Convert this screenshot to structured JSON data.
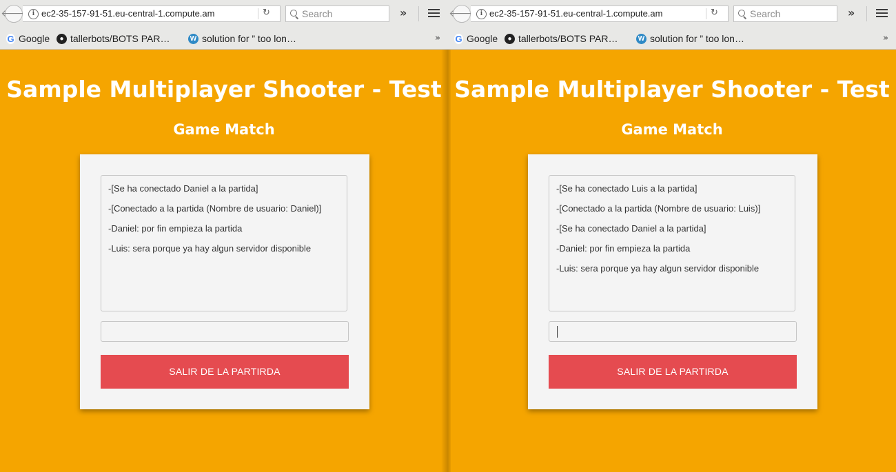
{
  "browser": {
    "url": "ec2-35-157-91-51.eu-central-1.compute.am",
    "search_placeholder": "Search",
    "bookmarks": [
      {
        "label": "Google",
        "icon": "google-icon"
      },
      {
        "label": "tallerbots/BOTS PAR…",
        "icon": "github-icon"
      },
      {
        "label": "solution for ” too lon…",
        "icon": "wordpress-icon"
      }
    ],
    "bookmarks_overflow": "»",
    "toolbar_overflow": "»"
  },
  "page": {
    "title": "Sample Multiplayer Shooter - Test",
    "subtitle": "Game Match",
    "exit_label": "SALIR DE LA PARTIRDA",
    "exit_color": "#e54b50",
    "background_color": "#f5a500"
  },
  "windows": [
    {
      "user": "Daniel",
      "chat": [
        "-[Se ha conectado Daniel a la partida]",
        "-[Conectado a la partida (Nombre de usuario: Daniel)]",
        "-Daniel: por fin empieza la partida",
        "-Luis: sera porque ya hay algun servidor disponible"
      ],
      "input_value": "",
      "input_focused": false
    },
    {
      "user": "Luis",
      "chat": [
        "-[Se ha conectado Luis a la partida]",
        "-[Conectado a la partida (Nombre de usuario: Luis)]",
        "-[Se ha conectado Daniel a la partida]",
        "-Daniel: por fin empieza la partida",
        "-Luis: sera porque ya hay algun servidor disponible"
      ],
      "input_value": "",
      "input_focused": true
    }
  ]
}
